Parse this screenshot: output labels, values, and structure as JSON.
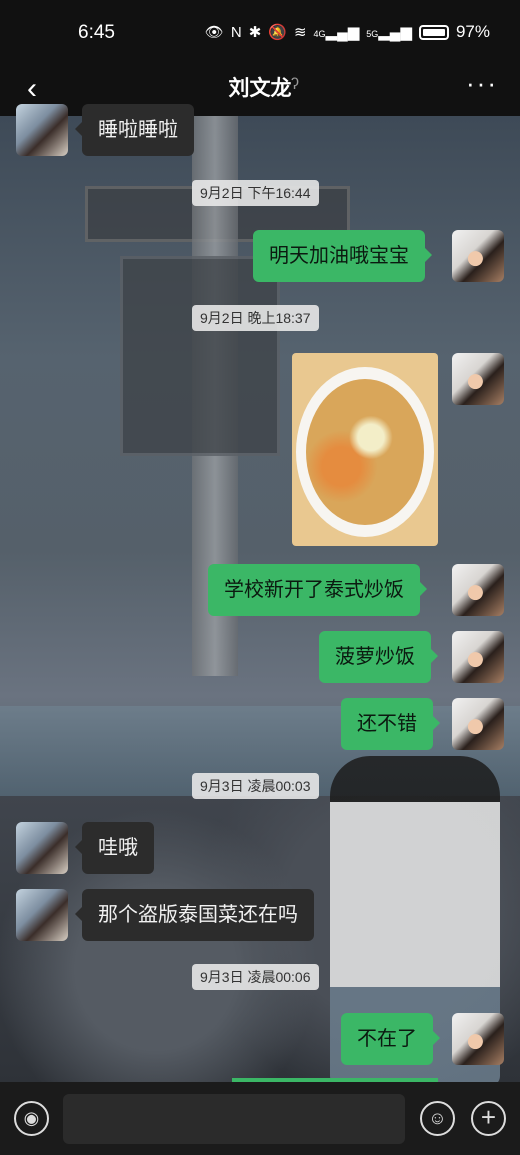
{
  "status_bar": {
    "time": "6:45",
    "battery": "97%",
    "signal_a": "4G",
    "signal_b": "5G"
  },
  "nav": {
    "title": "刘文龙"
  },
  "messages": {
    "m1": "睡啦睡啦",
    "t1": "9月2日 下午16:44",
    "m2": "明天加油哦宝宝",
    "t2": "9月2日 晚上18:37",
    "m3": "学校新开了泰式炒饭",
    "m4": "菠萝炒饭",
    "m5": "还不错",
    "t3": "9月3日 凌晨00:03",
    "m6": "哇哦",
    "m7": "那个盗版泰国菜还在吗",
    "t4": "9月3日 凌晨00:06",
    "m8": "不在了"
  },
  "input": {
    "placeholder": ""
  },
  "colors": {
    "accent": "#3bb766",
    "bubble_left": "#2c2c2c",
    "bar": "#111111"
  }
}
